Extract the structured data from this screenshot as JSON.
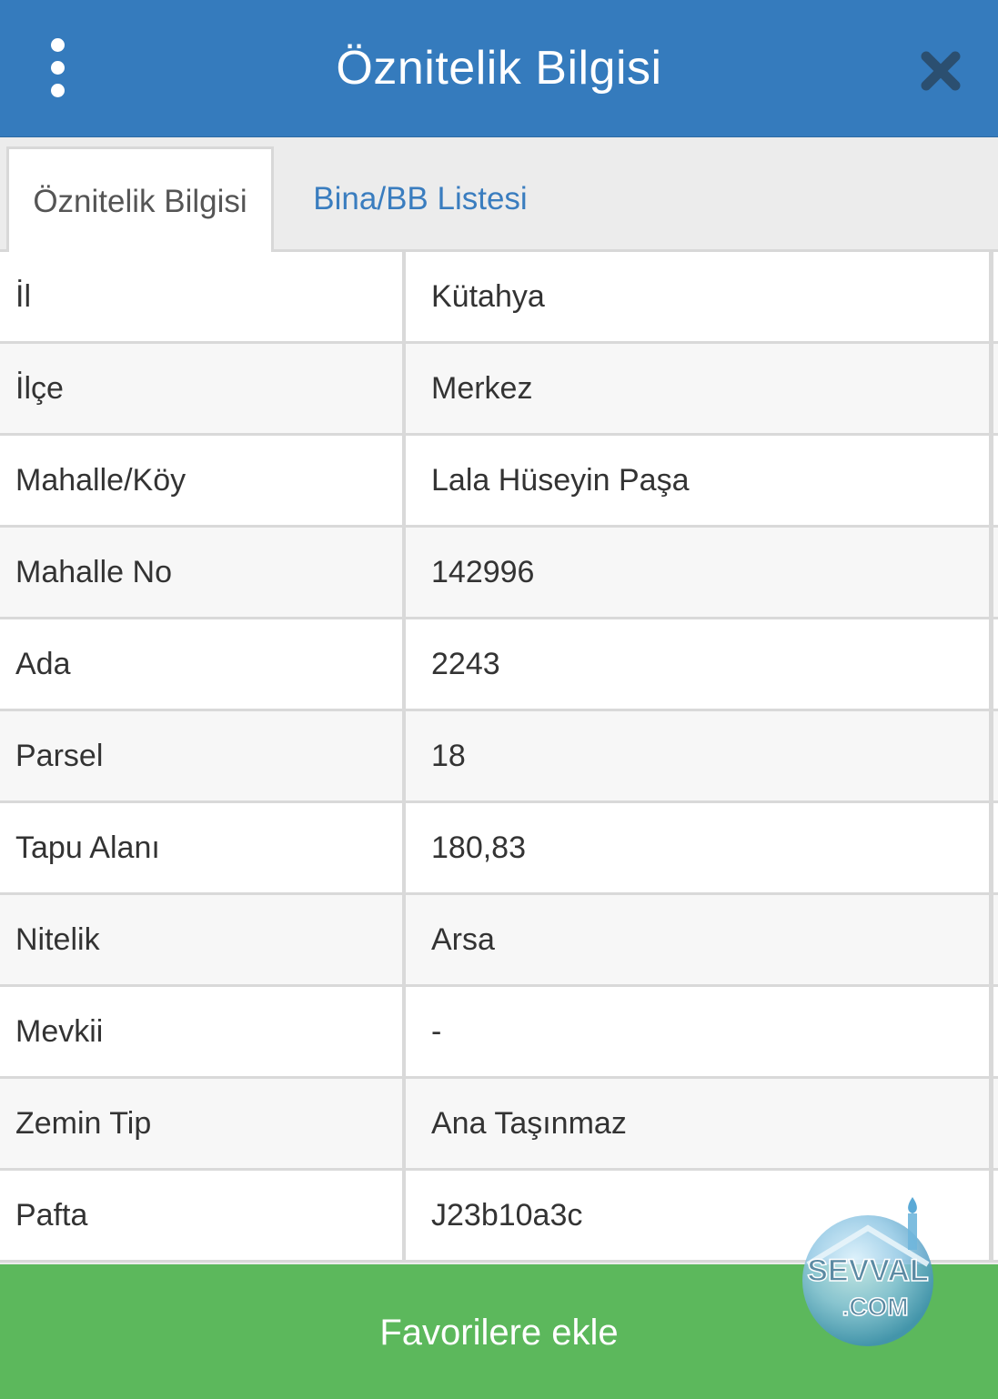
{
  "header": {
    "title": "Öznitelik Bilgisi",
    "menu_icon": "more-vertical-icon",
    "close_icon": "close-icon",
    "background_color": "#357bbd"
  },
  "tabs": [
    {
      "label": "Öznitelik Bilgisi",
      "active": true
    },
    {
      "label": "Bina/BB Listesi",
      "active": false
    }
  ],
  "attributes": [
    {
      "label": "İl",
      "value": "Kütahya"
    },
    {
      "label": "İlçe",
      "value": "Merkez"
    },
    {
      "label": "Mahalle/Köy",
      "value": "Lala Hüseyin Paşa"
    },
    {
      "label": "Mahalle No",
      "value": "142996"
    },
    {
      "label": "Ada",
      "value": "2243"
    },
    {
      "label": "Parsel",
      "value": "18"
    },
    {
      "label": "Tapu Alanı",
      "value": "180,83"
    },
    {
      "label": "Nitelik",
      "value": "Arsa"
    },
    {
      "label": "Mevkii",
      "value": "-"
    },
    {
      "label": "Zemin Tip",
      "value": "Ana Taşınmaz"
    },
    {
      "label": "Pafta",
      "value": "J23b10a3c"
    }
  ],
  "footer": {
    "favorite_label": "Favorilere ekle",
    "button_color": "#5cb85c"
  },
  "watermark": {
    "text_line1": "SEVVAL",
    "text_line2": ".COM"
  }
}
